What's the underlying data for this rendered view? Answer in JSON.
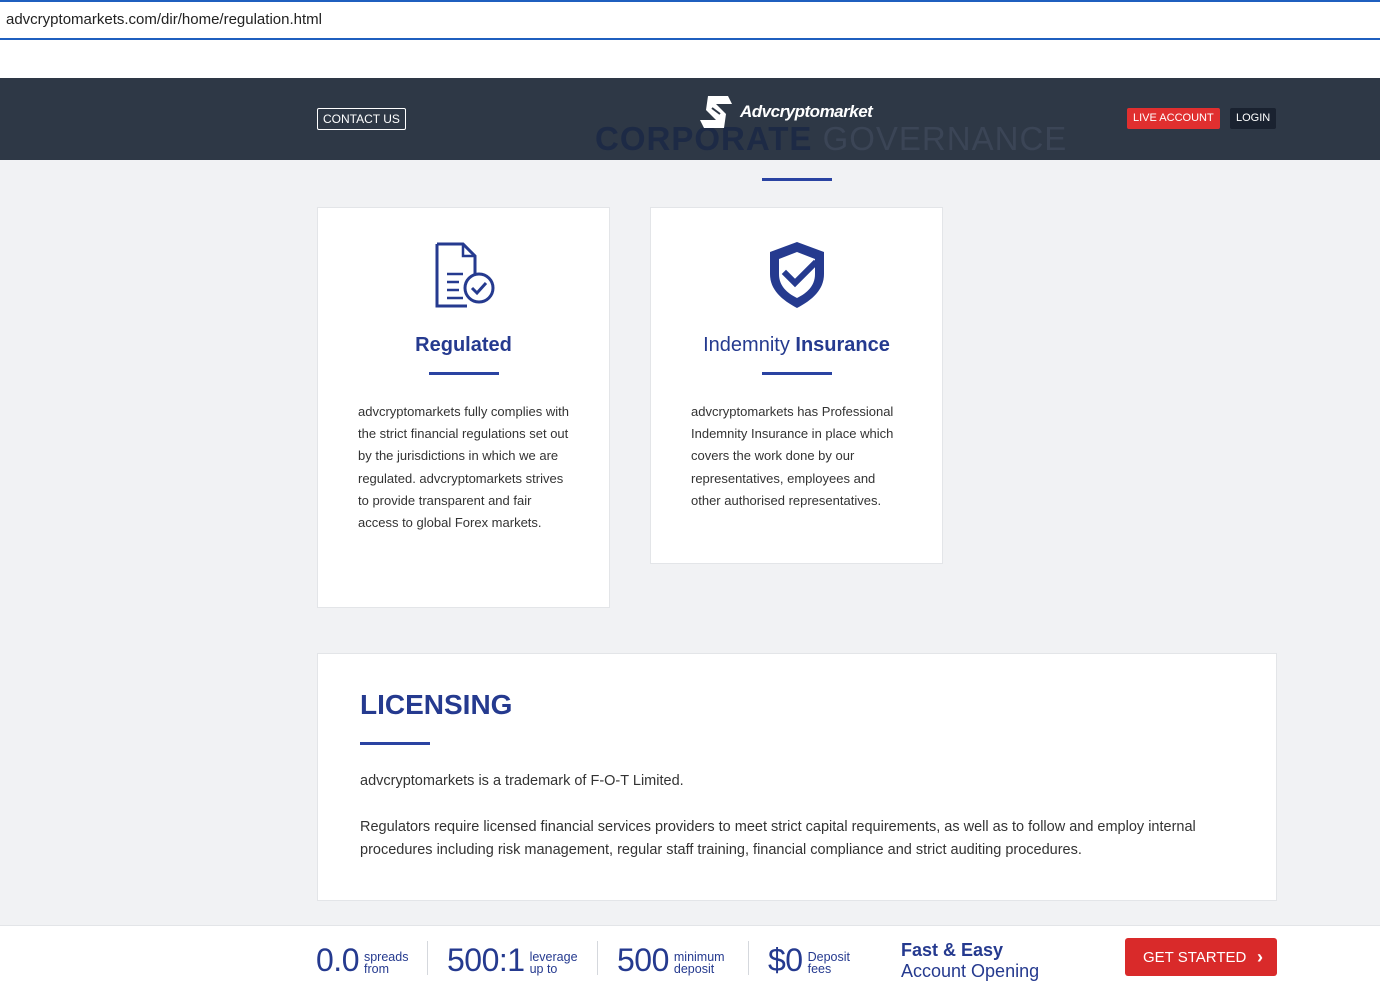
{
  "browser": {
    "url": "advcryptomarkets.com/dir/home/regulation.html"
  },
  "header": {
    "contact_label": "CONTACT US",
    "logo_text": "Advcryptomarket",
    "page_title_part1": "CORPORATE",
    "page_title_part2": " GOVERNANCE",
    "live_account_label": "LIVE ACCOUNT",
    "login_label": "LOGIN"
  },
  "cards": [
    {
      "icon": "document-check-icon",
      "title_light": "",
      "title_bold": "Regulated",
      "text": "advcryptomarkets fully complies with the strict financial regulations set out by the jurisdictions in which we are regulated. advcryptomarkets strives to provide transparent and fair access to global Forex markets."
    },
    {
      "icon": "shield-check-icon",
      "title_light": "Indemnity ",
      "title_bold": "Insurance",
      "text": "advcryptomarkets has Professional Indemnity Insurance in place which covers the work done by our representatives, employees and other authorised representatives."
    }
  ],
  "licensing": {
    "title": "LICENSING",
    "paragraph1": "advcryptomarkets is a trademark of F-O-T Limited.",
    "paragraph2": "Regulators require licensed financial services providers to meet strict capital requirements, as well as to follow and employ internal procedures including risk management, regular staff training, financial compliance and strict auditing procedures."
  },
  "bottom_bar": {
    "stats": [
      {
        "value": "0.0",
        "label1": "spreads",
        "label2": "from"
      },
      {
        "value": "500:1",
        "label1": "leverage",
        "label2": "up to"
      },
      {
        "value": "500",
        "label1": "minimum",
        "label2": "deposit"
      },
      {
        "value": "$0",
        "label1": "Deposit",
        "label2": "fees"
      }
    ],
    "tagline_line1": "Fast & Easy",
    "tagline_line2": "Account Opening",
    "cta_label": "GET STARTED"
  },
  "colors": {
    "header_bg": "#2e3846",
    "brand_blue": "#253a8f",
    "accent_red": "#e02f2f"
  }
}
